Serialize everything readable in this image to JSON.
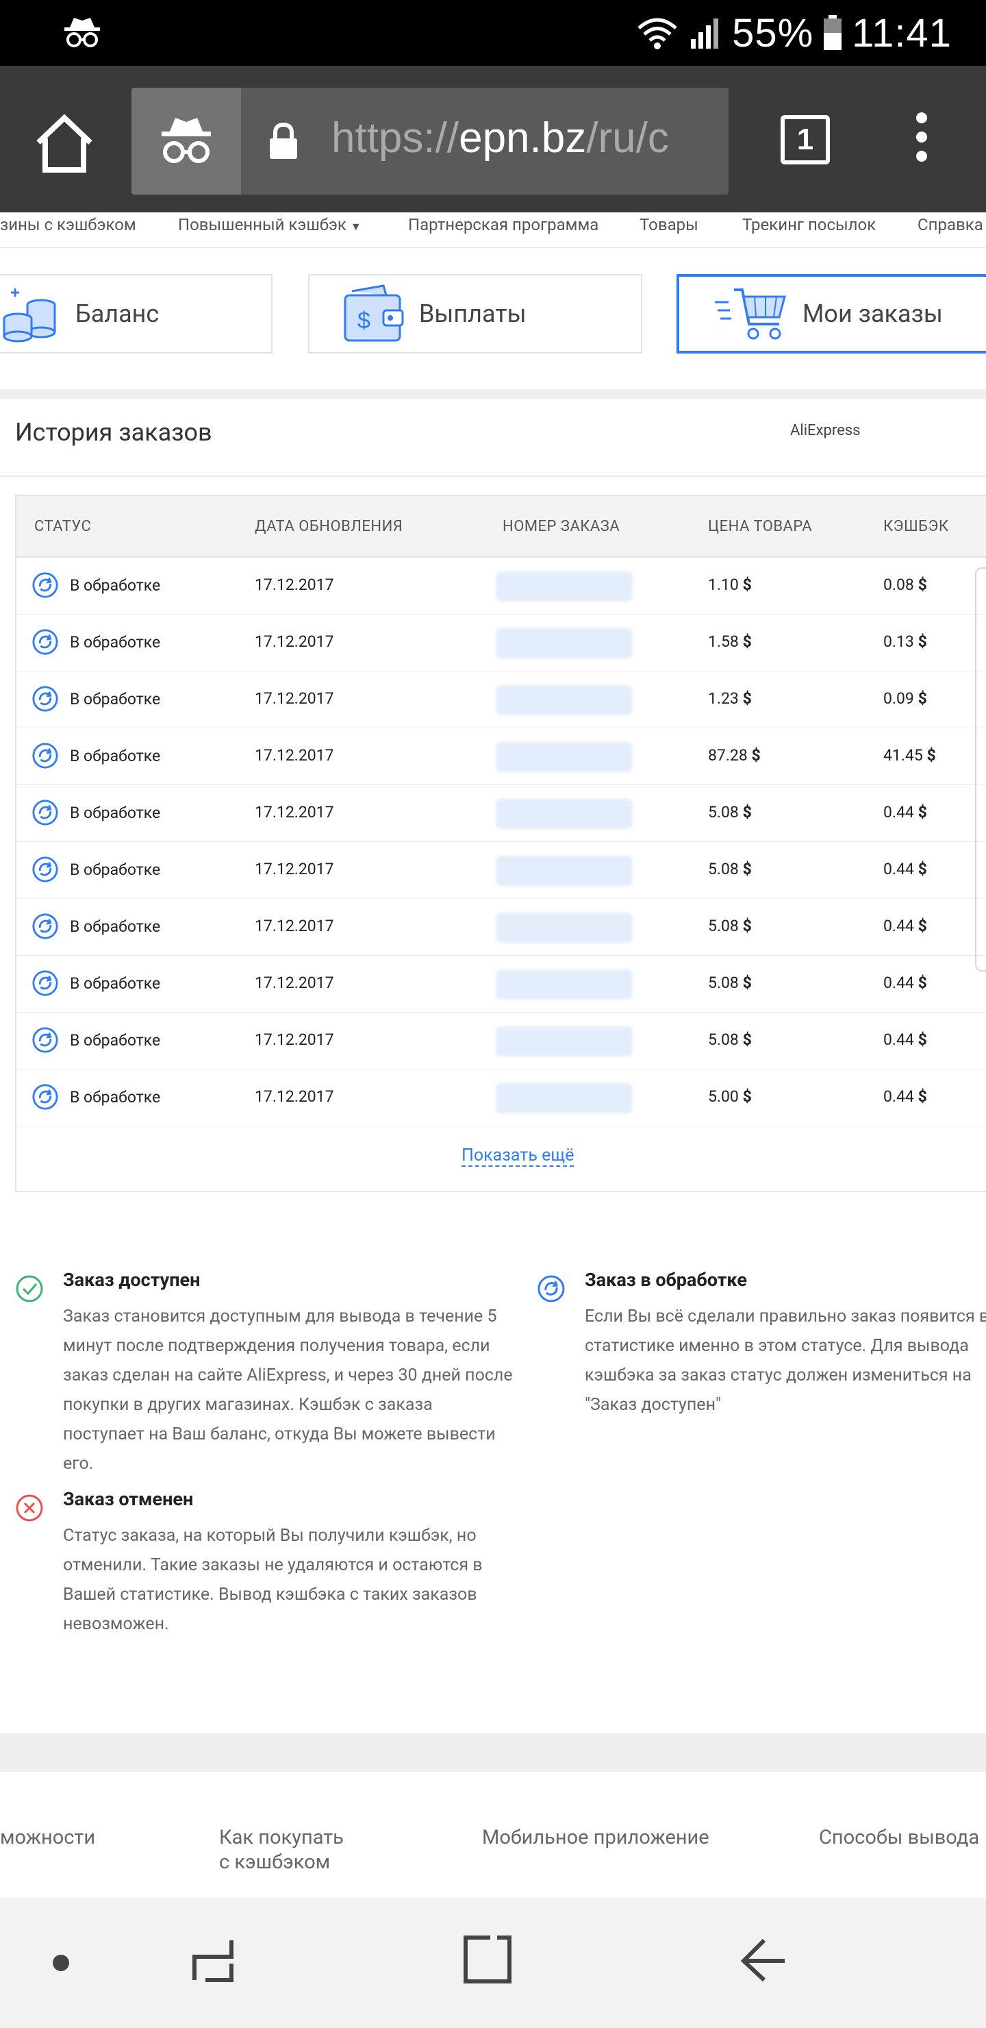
{
  "statusbar": {
    "battery": "55%",
    "time": "11:41"
  },
  "browser": {
    "url_prefix": "https://",
    "url_domain": "epn.bz",
    "url_suffix": "/ru/c",
    "tab_count": "1"
  },
  "sitenav": {
    "items": [
      "зины с кэшбэком",
      "Повышенный кэшбэк",
      "Партнерская программа",
      "Товары",
      "Трекинг посылок",
      "Справка"
    ]
  },
  "cards": {
    "balance": "Баланс",
    "payouts": "Выплаты",
    "orders": "Мои заказы"
  },
  "history": {
    "title": "История заказов",
    "shop": "AliExpress",
    "columns": {
      "status": "СТАТУС",
      "date": "ДАТА ОБНОВЛЕНИЯ",
      "order_number": "НОМЕР ЗАКАЗА",
      "price": "ЦЕНА ТОВАРА",
      "cashback": "КЭШБЭК"
    },
    "currency": "$",
    "rows": [
      {
        "status": "В обработке",
        "date": "17.12.2017",
        "price": "1.10",
        "cashback": "0.08"
      },
      {
        "status": "В обработке",
        "date": "17.12.2017",
        "price": "1.58",
        "cashback": "0.13"
      },
      {
        "status": "В обработке",
        "date": "17.12.2017",
        "price": "1.23",
        "cashback": "0.09"
      },
      {
        "status": "В обработке",
        "date": "17.12.2017",
        "price": "87.28",
        "cashback": "41.45"
      },
      {
        "status": "В обработке",
        "date": "17.12.2017",
        "price": "5.08",
        "cashback": "0.44"
      },
      {
        "status": "В обработке",
        "date": "17.12.2017",
        "price": "5.08",
        "cashback": "0.44"
      },
      {
        "status": "В обработке",
        "date": "17.12.2017",
        "price": "5.08",
        "cashback": "0.44"
      },
      {
        "status": "В обработке",
        "date": "17.12.2017",
        "price": "5.08",
        "cashback": "0.44"
      },
      {
        "status": "В обработке",
        "date": "17.12.2017",
        "price": "5.08",
        "cashback": "0.44"
      },
      {
        "status": "В обработке",
        "date": "17.12.2017",
        "price": "5.00",
        "cashback": "0.44"
      }
    ],
    "show_more": "Показать ещё"
  },
  "legend": {
    "available": {
      "title": "Заказ доступен",
      "text": "Заказ становится доступным для вывода в течение 5 минут после подтверждения получения товара, если заказ сделан на сайте AliExpress, и через 30 дней после покупки в других магазинах. Кэшбэк с заказа поступает на Ваш баланс, откуда Вы можете вывести его."
    },
    "processing": {
      "title": "Заказ в обработке",
      "text": "Если Вы всё сделали правильно заказ появится в статистике именно в этом статусе. Для вывода кэшбэка за заказ статус должен измениться на \"Заказ доступен\""
    },
    "cancelled": {
      "title": "Заказ отменен",
      "text": "Статус заказа, на который Вы получили кэшбэк, но отменили. Такие заказы не удаляются и остаются в Вашей статистике. Вывод кэшбэка с таких заказов невозможен."
    }
  },
  "footer": {
    "items": [
      "можности",
      "Как покупать",
      "с кэшбэком",
      "Мобильное приложение",
      "Способы вывода"
    ]
  },
  "colors": {
    "accent": "#2f7cf6",
    "available": "#3cb371",
    "cancelled": "#e8504f"
  }
}
